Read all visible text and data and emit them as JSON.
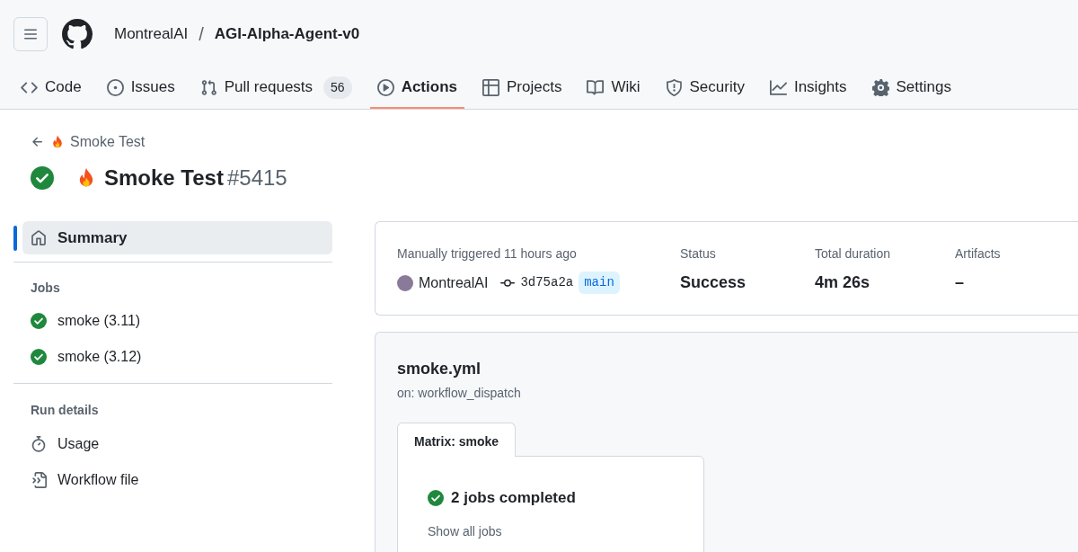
{
  "header": {
    "owner": "MontrealAI",
    "separator": "/",
    "repo": "AGI-Alpha-Agent-v0"
  },
  "tabs": [
    {
      "label": "Code",
      "kind": "code",
      "selected": false
    },
    {
      "label": "Issues",
      "kind": "issue",
      "selected": false
    },
    {
      "label": "Pull requests",
      "kind": "pull",
      "count": "56",
      "selected": false
    },
    {
      "label": "Actions",
      "kind": "play",
      "selected": true
    },
    {
      "label": "Projects",
      "kind": "table",
      "selected": false
    },
    {
      "label": "Wiki",
      "kind": "book",
      "selected": false
    },
    {
      "label": "Security",
      "kind": "shield",
      "selected": false
    },
    {
      "label": "Insights",
      "kind": "graph",
      "selected": false
    },
    {
      "label": "Settings",
      "kind": "gear",
      "selected": false
    }
  ],
  "breadcrumb": {
    "label": "Smoke Test"
  },
  "run": {
    "passed": true,
    "title": "Smoke Test",
    "number": "#5415"
  },
  "sidebar": {
    "summary": {
      "label": "Summary",
      "selected": true
    },
    "jobs_heading": "Jobs",
    "jobs": [
      {
        "label": "smoke (3.11)",
        "passed": true
      },
      {
        "label": "smoke (3.12)",
        "passed": true
      }
    ],
    "details_heading": "Run details",
    "details": [
      {
        "label": "Usage",
        "kind": "stopwatch"
      },
      {
        "label": "Workflow file",
        "kind": "file"
      }
    ]
  },
  "summary_card": {
    "trigger": "Manually triggered 11 hours ago",
    "actor": "MontrealAI",
    "commit": "3d75a2a",
    "branch": "main",
    "stats": [
      {
        "label": "Status",
        "value": "Success"
      },
      {
        "label": "Total duration",
        "value": "4m 26s"
      },
      {
        "label": "Artifacts",
        "value": "–"
      }
    ]
  },
  "workflow": {
    "file": "smoke.yml",
    "trigger": "on: workflow_dispatch",
    "matrix_tab": "Matrix: smoke",
    "passed": true,
    "jobs_text": "2 jobs completed",
    "show_all": "Show all jobs"
  }
}
